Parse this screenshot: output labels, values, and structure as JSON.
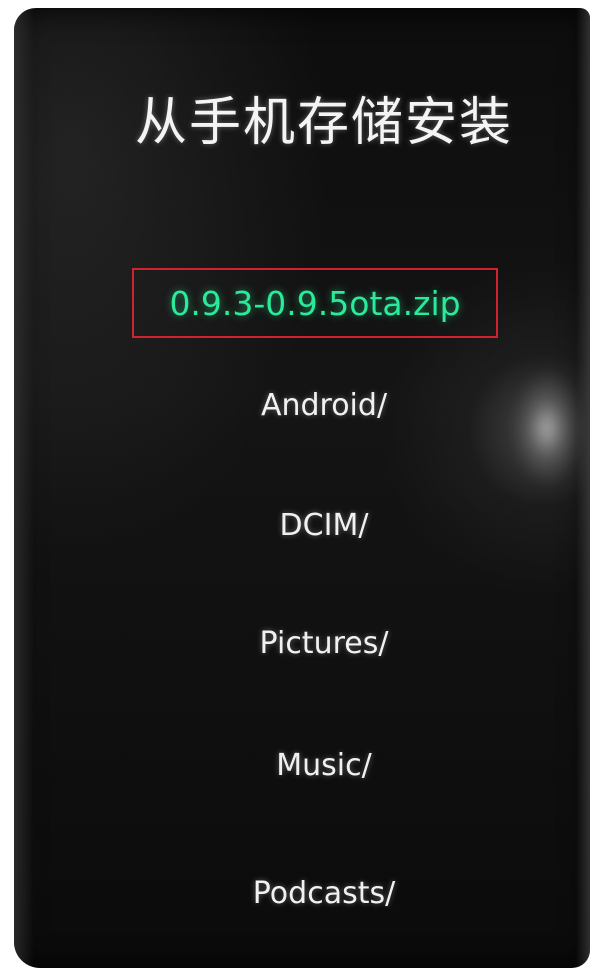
{
  "title": "从手机存储安装",
  "selected_file": "0.9.3-0.9.5ota.zip",
  "directory_items": [
    {
      "label": "Android/"
    },
    {
      "label": "DCIM/"
    },
    {
      "label": "Pictures/"
    },
    {
      "label": "Music/"
    },
    {
      "label": "Podcasts/"
    }
  ],
  "colors": {
    "background": "#111111",
    "text": "#f1f1f1",
    "selected_text": "#2bea9a",
    "highlight_border": "#d1232f"
  }
}
